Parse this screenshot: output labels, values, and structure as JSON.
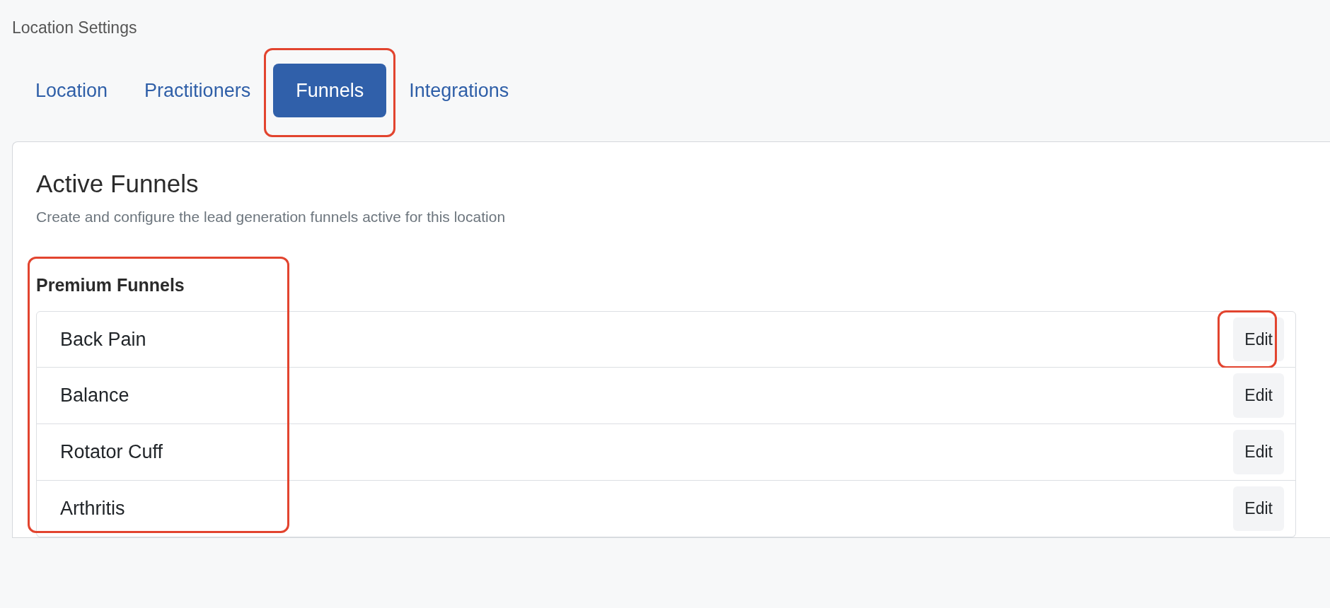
{
  "page_title": "Location Settings",
  "tabs": [
    {
      "label": "Location",
      "selected": false,
      "highlighted": false
    },
    {
      "label": "Practitioners",
      "selected": false,
      "highlighted": false
    },
    {
      "label": "Funnels",
      "selected": true,
      "highlighted": true
    },
    {
      "label": "Integrations",
      "selected": false,
      "highlighted": false
    }
  ],
  "card": {
    "title": "Active Funnels",
    "subtitle": "Create and configure the lead generation funnels active for this location",
    "section": {
      "title": "Premium Funnels",
      "highlighted": true,
      "rows": [
        {
          "name": "Back Pain",
          "button": "Edit",
          "highlighted": true
        },
        {
          "name": "Balance",
          "button": "Edit",
          "highlighted": false
        },
        {
          "name": "Rotator Cuff",
          "button": "Edit",
          "highlighted": false
        },
        {
          "name": "Arthritis",
          "button": "Edit",
          "highlighted": false
        }
      ]
    }
  }
}
